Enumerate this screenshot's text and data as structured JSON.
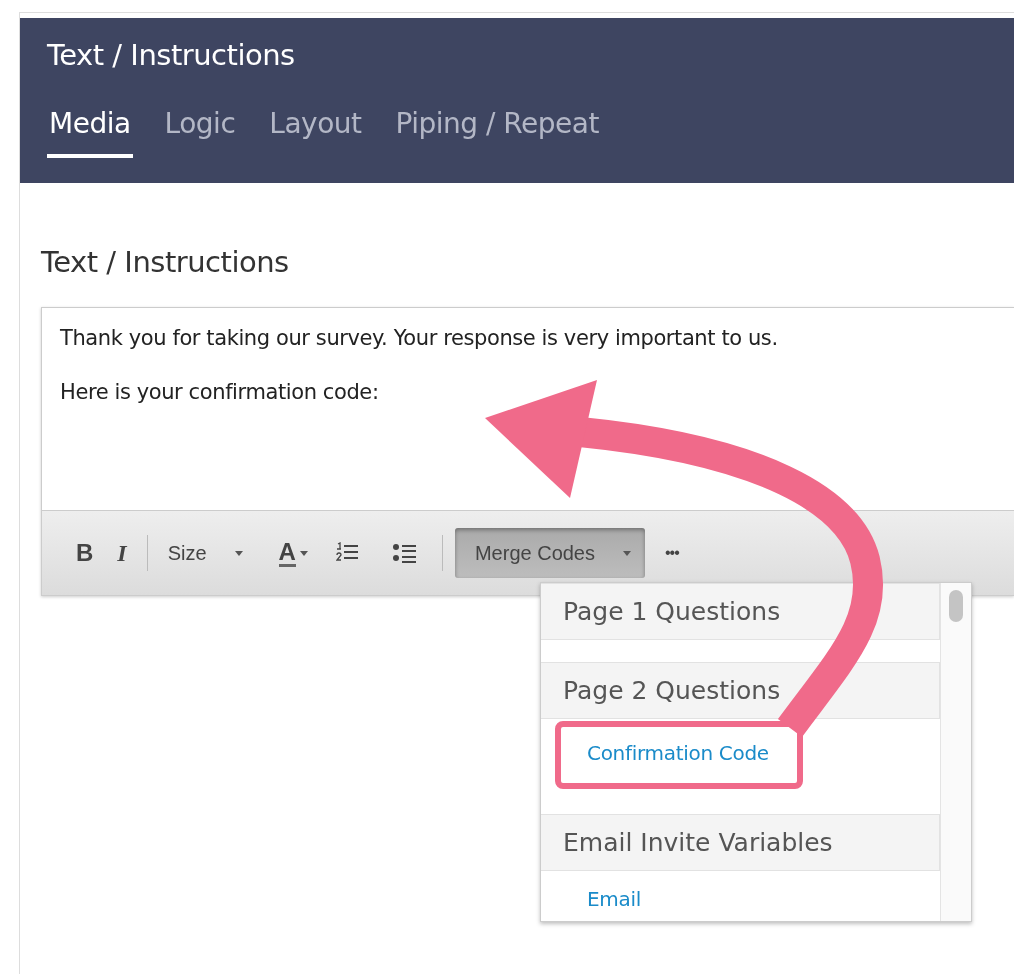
{
  "dialog": {
    "title": "Text / Instructions"
  },
  "tabs": [
    {
      "label": "Media",
      "selected": true
    },
    {
      "label": "Logic",
      "selected": false
    },
    {
      "label": "Layout",
      "selected": false
    },
    {
      "label": "Piping / Repeat",
      "selected": false
    }
  ],
  "section_title": "Text / Instructions",
  "editor": {
    "paragraphs": [
      "Thank you for taking our survey. Your response is very important to us.",
      "Here is your confirmation code:"
    ],
    "toolbar": [
      {
        "kind": "bold",
        "label": "B"
      },
      {
        "kind": "italic",
        "label": "I"
      },
      {
        "kind": "separator"
      },
      {
        "kind": "dropdown",
        "label": "Size",
        "pressed": false
      },
      {
        "kind": "color",
        "label": "A"
      },
      {
        "kind": "ordered-list"
      },
      {
        "kind": "bullet-list"
      },
      {
        "kind": "separator"
      },
      {
        "kind": "dropdown",
        "label": "Merge Codes",
        "pressed": true
      },
      {
        "kind": "more",
        "label": "•••"
      }
    ]
  },
  "merge_menu": {
    "items": [
      {
        "kind": "header",
        "label": "Page 1 Questions"
      },
      {
        "kind": "spacer"
      },
      {
        "kind": "header",
        "label": "Page 2 Questions"
      },
      {
        "kind": "link",
        "label": "Confirmation Code",
        "highlighted": true
      },
      {
        "kind": "header",
        "label": "Email Invite Variables"
      },
      {
        "kind": "link",
        "label": "Email",
        "highlighted": false
      }
    ]
  }
}
